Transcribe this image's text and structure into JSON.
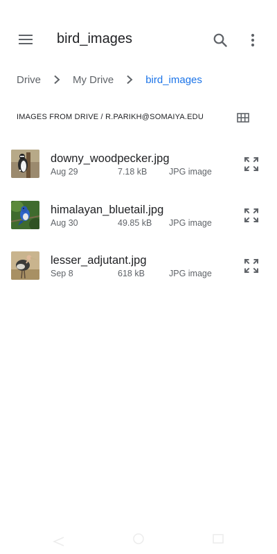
{
  "appbar": {
    "title": "bird_images",
    "icons": {
      "menu": "menu-icon",
      "search": "search-icon",
      "more": "more-vert-icon"
    }
  },
  "breadcrumb": {
    "items": [
      "Drive",
      "My Drive",
      "bird_images"
    ]
  },
  "section": {
    "label": "IMAGES FROM DRIVE / R.PARIKH@SOMAIYA.EDU",
    "view_icon": "grid-view-icon"
  },
  "files": [
    {
      "name": "downy_woodpecker.jpg",
      "date": "Aug 29",
      "size": "7.18 kB",
      "type": "JPG image",
      "thumb_icon": "woodpecker-thumbnail"
    },
    {
      "name": "himalayan_bluetail.jpg",
      "date": "Aug 30",
      "size": "49.85 kB",
      "type": "JPG image",
      "thumb_icon": "bluetail-thumbnail"
    },
    {
      "name": "lesser_adjutant.jpg",
      "date": "Sep 8",
      "size": "618 kB",
      "type": "JPG image",
      "thumb_icon": "adjutant-thumbnail"
    }
  ],
  "colors": {
    "accent": "#1a73e8",
    "text_primary": "#202124",
    "text_secondary": "#5f6368",
    "icon": "#5f6368"
  }
}
